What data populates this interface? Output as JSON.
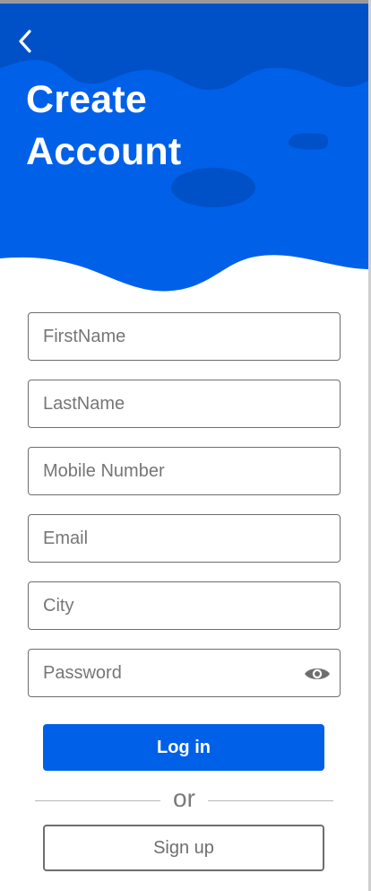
{
  "header": {
    "title_line1": "Create",
    "title_line2": "Account",
    "back_icon": "chevron-left-icon"
  },
  "form": {
    "firstname_placeholder": "FirstName",
    "lastname_placeholder": "LastName",
    "mobile_placeholder": "Mobile Number",
    "email_placeholder": "Email",
    "city_placeholder": "City",
    "password_placeholder": "Password",
    "password_toggle_icon": "eye-icon"
  },
  "actions": {
    "login_label": "Log in",
    "or_label": "or",
    "signup_label": "Sign up"
  },
  "colors": {
    "primary": "#0060e8",
    "primary_dark": "#0051c7",
    "border": "#6e6e6e"
  }
}
